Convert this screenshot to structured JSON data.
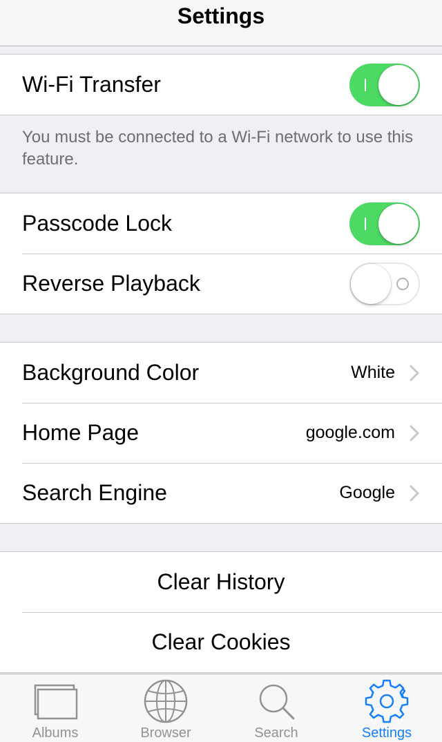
{
  "navbar": {
    "title": "Settings"
  },
  "wifi": {
    "label": "Wi-Fi Transfer",
    "enabled": true,
    "note": "You must be connected to a Wi-Fi network to use this feature."
  },
  "security": {
    "passcode_label": "Passcode Lock",
    "passcode_enabled": true,
    "reverse_label": "Reverse Playback",
    "reverse_enabled": false
  },
  "prefs": {
    "background_label": "Background Color",
    "background_value": "White",
    "homepage_label": "Home Page",
    "homepage_value": "google.com",
    "search_label": "Search Engine",
    "search_value": "Google"
  },
  "actions": {
    "clear_history": "Clear History",
    "clear_cookies": "Clear Cookies"
  },
  "tabbar": {
    "albums": "Albums",
    "browser": "Browser",
    "search": "Search",
    "settings": "Settings",
    "active": "settings",
    "active_color": "#157efb",
    "inactive_color": "#929292"
  },
  "colors": {
    "toggle_on": "#4cd964"
  }
}
